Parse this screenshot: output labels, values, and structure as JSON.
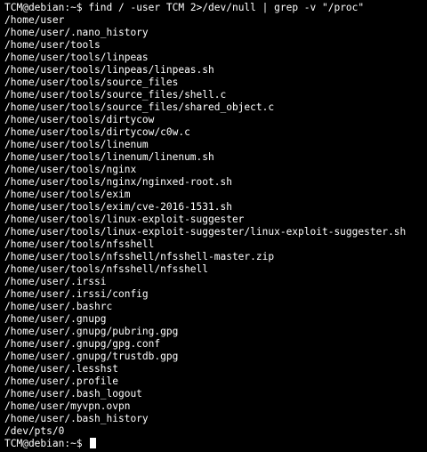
{
  "terminal": {
    "colors": {
      "background": "#000000",
      "foreground": "#ffffff"
    },
    "prompt": "TCM@debian:~$",
    "command": "find / -user TCM 2>/dev/null | grep -v \"/proc\"",
    "output": [
      "/home/user",
      "/home/user/.nano_history",
      "/home/user/tools",
      "/home/user/tools/linpeas",
      "/home/user/tools/linpeas/linpeas.sh",
      "/home/user/tools/source_files",
      "/home/user/tools/source_files/shell.c",
      "/home/user/tools/source_files/shared_object.c",
      "/home/user/tools/dirtycow",
      "/home/user/tools/dirtycow/c0w.c",
      "/home/user/tools/linenum",
      "/home/user/tools/linenum/linenum.sh",
      "/home/user/tools/nginx",
      "/home/user/tools/nginx/nginxed-root.sh",
      "/home/user/tools/exim",
      "/home/user/tools/exim/cve-2016-1531.sh",
      "/home/user/tools/linux-exploit-suggester",
      "/home/user/tools/linux-exploit-suggester/linux-exploit-suggester.sh",
      "/home/user/tools/nfsshell",
      "/home/user/tools/nfsshell/nfsshell-master.zip",
      "/home/user/tools/nfsshell/nfsshell",
      "/home/user/.irssi",
      "/home/user/.irssi/config",
      "/home/user/.bashrc",
      "/home/user/.gnupg",
      "/home/user/.gnupg/pubring.gpg",
      "/home/user/.gnupg/gpg.conf",
      "/home/user/.gnupg/trustdb.gpg",
      "/home/user/.lesshst",
      "/home/user/.profile",
      "/home/user/.bash_logout",
      "/home/user/myvpn.ovpn",
      "/home/user/.bash_history",
      "/dev/pts/0"
    ]
  }
}
